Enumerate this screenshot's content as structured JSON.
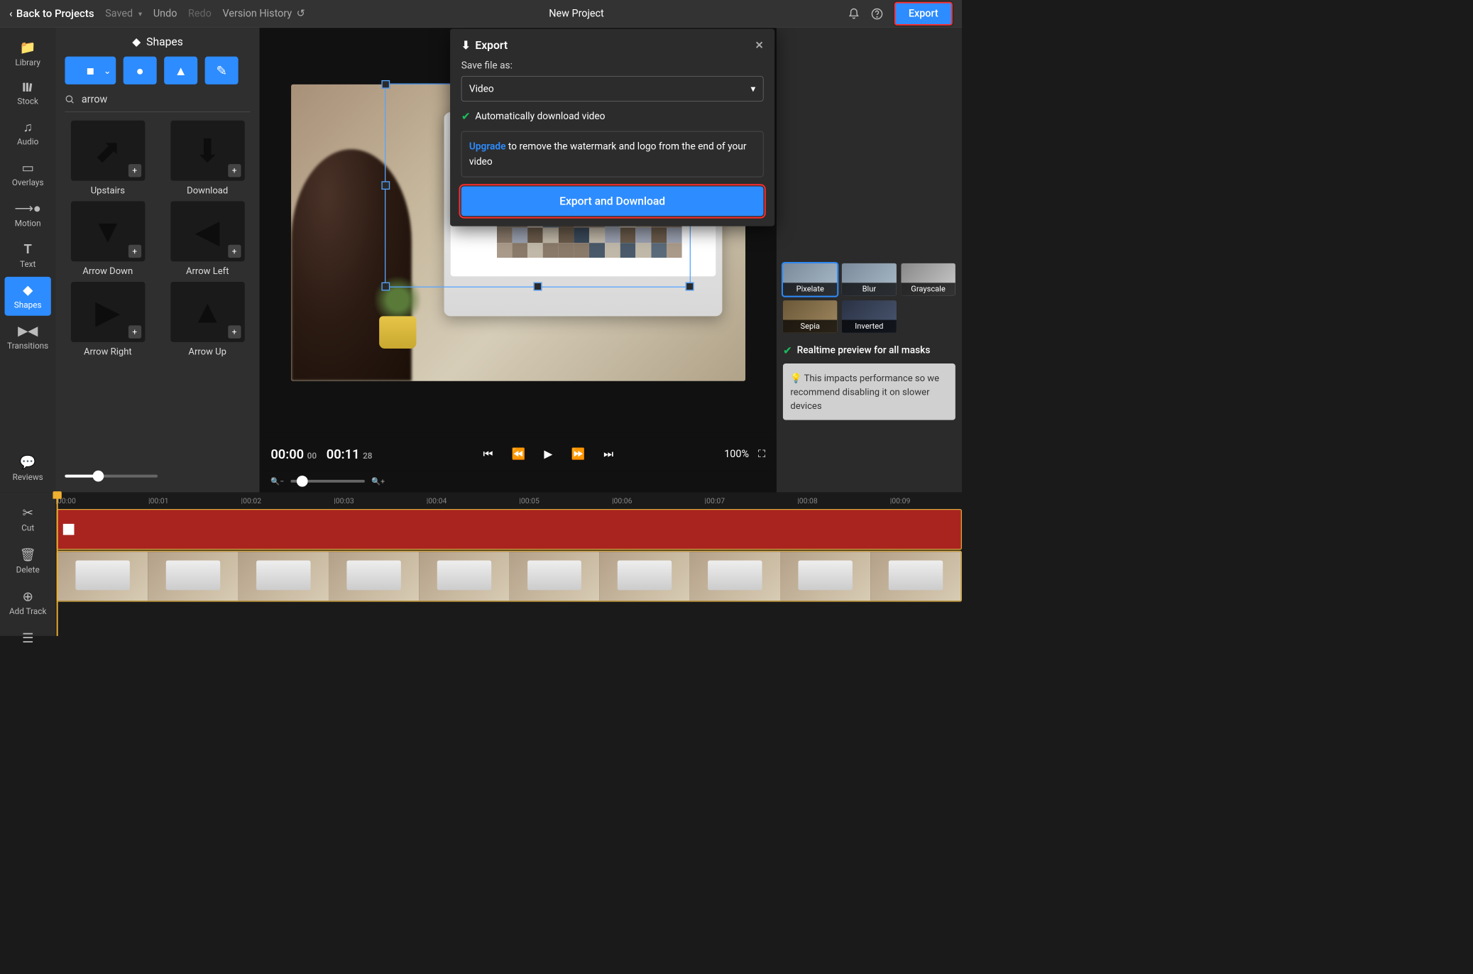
{
  "topbar": {
    "back": "Back to Projects",
    "saved": "Saved",
    "undo": "Undo",
    "redo": "Redo",
    "history": "Version History",
    "title": "New Project",
    "export": "Export"
  },
  "leftnav": {
    "library": "Library",
    "stock": "Stock",
    "audio": "Audio",
    "overlays": "Overlays",
    "motion": "Motion",
    "text": "Text",
    "shapes": "Shapes",
    "transitions": "Transitions",
    "reviews": "Reviews"
  },
  "shapes_panel": {
    "title": "Shapes",
    "search": "arrow",
    "items": [
      "Upstairs",
      "Download",
      "Arrow Down",
      "Arrow Left",
      "Arrow Right",
      "Arrow Up"
    ]
  },
  "player": {
    "time_cur": "00:00",
    "time_cur_f": "00",
    "time_dur": "00:11",
    "time_dur_f": "28",
    "zoom": "100%"
  },
  "rightpanel": {
    "filters": [
      "Pixelate",
      "Blur",
      "Grayscale",
      "Sepia",
      "Inverted"
    ],
    "realtime": "Realtime preview for all masks",
    "hint": "This impacts performance so we recommend disabling it on slower devices"
  },
  "export": {
    "title": "Export",
    "save_as": "Save file as:",
    "type": "Video",
    "auto": "Automatically download video",
    "upgrade": "Upgrade",
    "upsell_rest": " to remove the watermark and logo from the end of your video",
    "button": "Export and Download"
  },
  "timeline": {
    "cut": "Cut",
    "delete": "Delete",
    "addtrack": "Add Track",
    "ticks": [
      "00:00",
      "00:01",
      "00:02",
      "00:03",
      "00:04",
      "00:05",
      "00:06",
      "00:07",
      "00:08",
      "00:09"
    ]
  }
}
